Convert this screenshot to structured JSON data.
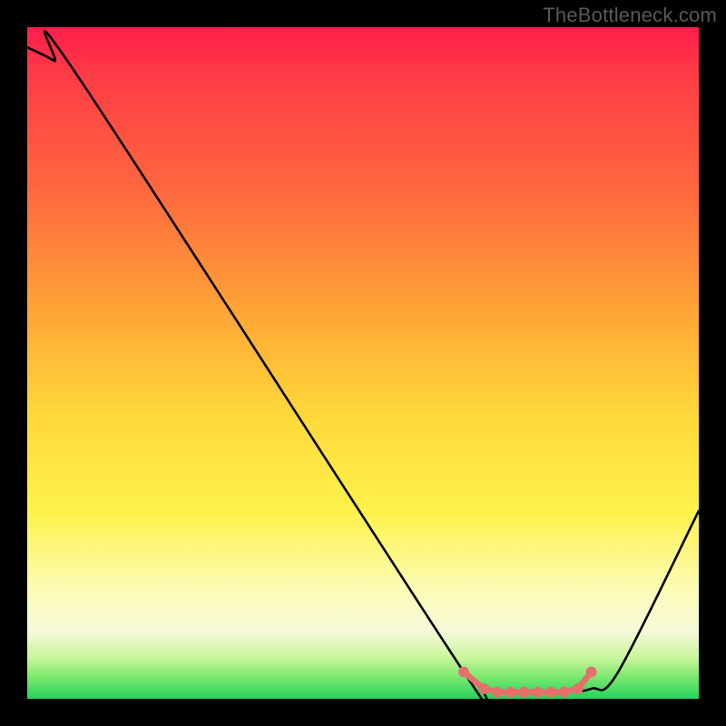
{
  "watermark": "TheBottleneck.com",
  "chart_data": {
    "type": "line",
    "title": "",
    "xlabel": "",
    "ylabel": "",
    "xlim": [
      0,
      100
    ],
    "ylim": [
      0,
      100
    ],
    "series": [
      {
        "name": "bottleneck-curve",
        "x": [
          0,
          4,
          8,
          65,
          68,
          72,
          76,
          80,
          84,
          88,
          100
        ],
        "values": [
          97,
          95,
          92,
          4,
          1.5,
          1,
          1,
          1,
          1.5,
          4,
          28
        ]
      },
      {
        "name": "optimal-marker",
        "x": [
          65,
          68,
          70,
          72,
          74,
          76,
          78,
          80,
          82,
          84
        ],
        "values": [
          4,
          1.5,
          1,
          1,
          1,
          1,
          1,
          1,
          1.5,
          4
        ]
      }
    ],
    "gradient_stops": [
      {
        "pos": 0,
        "color": "#ff1d4a"
      },
      {
        "pos": 25,
        "color": "#ff6a3e"
      },
      {
        "pos": 58,
        "color": "#ffd93a"
      },
      {
        "pos": 84,
        "color": "#fcfcb8"
      },
      {
        "pos": 97,
        "color": "#75e76c"
      },
      {
        "pos": 100,
        "color": "#24d35e"
      }
    ]
  }
}
